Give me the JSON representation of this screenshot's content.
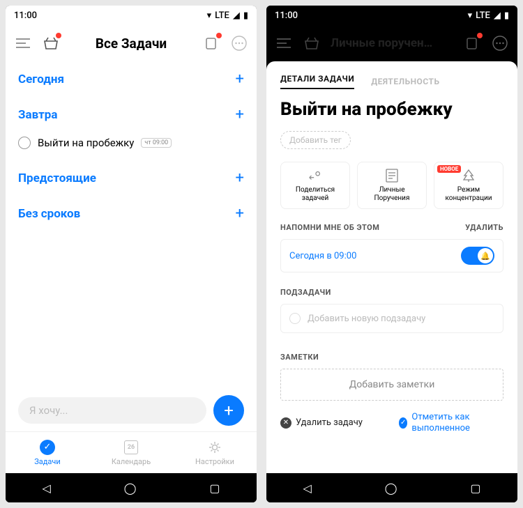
{
  "status": {
    "time": "11:00",
    "net": "LTE",
    "wifi": "▾",
    "signal": "◢",
    "batt": "▮"
  },
  "left": {
    "header_title": "Все Задачи",
    "sections": {
      "today": "Сегодня",
      "tomorrow": "Завтра",
      "upcoming": "Предстоящие",
      "nodate": "Без сроков"
    },
    "plus": "+",
    "task1": {
      "title": "Выйти на пробежку",
      "badge": "чт 09:00"
    },
    "quickadd_placeholder": "Я хочу...",
    "tabs": {
      "tasks": "Задачи",
      "calendar": "Календарь",
      "calendar_day": "26",
      "settings": "Настройки"
    }
  },
  "right": {
    "dim_title": "Личные поручен…",
    "tabs": {
      "details": "ДЕТАЛИ ЗАДАЧИ",
      "activity": "ДЕЯТЕЛЬНОСТЬ"
    },
    "title": "Выйти на пробежку",
    "add_tag": "Добавить тег",
    "cards": {
      "share": "Поделиться задачей",
      "list": "Личные Поручения",
      "focus": "Режим концентрации",
      "new_badge": "НОВОЕ"
    },
    "reminder": {
      "label": "НАПОМНИ МНЕ ОБ ЭТОМ",
      "delete": "УДАЛИТЬ",
      "text": "Сегодня в 09:00"
    },
    "subtasks": {
      "label": "ПОДЗАДАЧИ",
      "placeholder": "Добавить новую подзадачу"
    },
    "notes": {
      "label": "ЗАМЕТКИ",
      "placeholder": "Добавить заметки"
    },
    "actions": {
      "delete": "Удалить задачу",
      "done": "Отметить как выполненное"
    }
  }
}
